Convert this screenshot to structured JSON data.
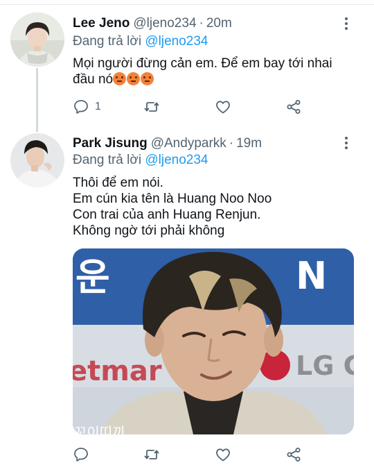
{
  "tweets": [
    {
      "name": "Lee Jeno",
      "handle": "@ljeno234",
      "time": "20m",
      "reply_prefix": "Đang trả lời",
      "reply_to": "@ljeno234",
      "text_lines": [
        "Mọi người đừng cản em. Để em bay tới nhai",
        "đầu nó"
      ],
      "emojis": [
        "angry-face-emoji",
        "angry-face-emoji",
        "angry-face-emoji"
      ],
      "reply_count": "1",
      "icons": [
        "reply-icon",
        "retweet-icon",
        "like-icon",
        "share-icon",
        "more-icon"
      ]
    },
    {
      "name": "Park Jisung",
      "handle": "@Andyparkk",
      "time": "19m",
      "reply_prefix": "Đang trả lời",
      "reply_to": "@ljeno234",
      "text_lines": [
        "Thôi để em nói.",
        "Em cún kia tên là Huang Noo Noo",
        "Con trai của anh Huang Renjun.",
        "Không ngờ tới phải không"
      ],
      "media": {
        "background_signage": [
          "운",
          "N",
          "etmar",
          "LG C"
        ],
        "caption_fragment": "꼬이띠끼"
      }
    }
  ],
  "colors": {
    "accent": "#1d9bf0",
    "muted": "#536471",
    "text": "#0f1419",
    "line": "#cfd9de"
  }
}
